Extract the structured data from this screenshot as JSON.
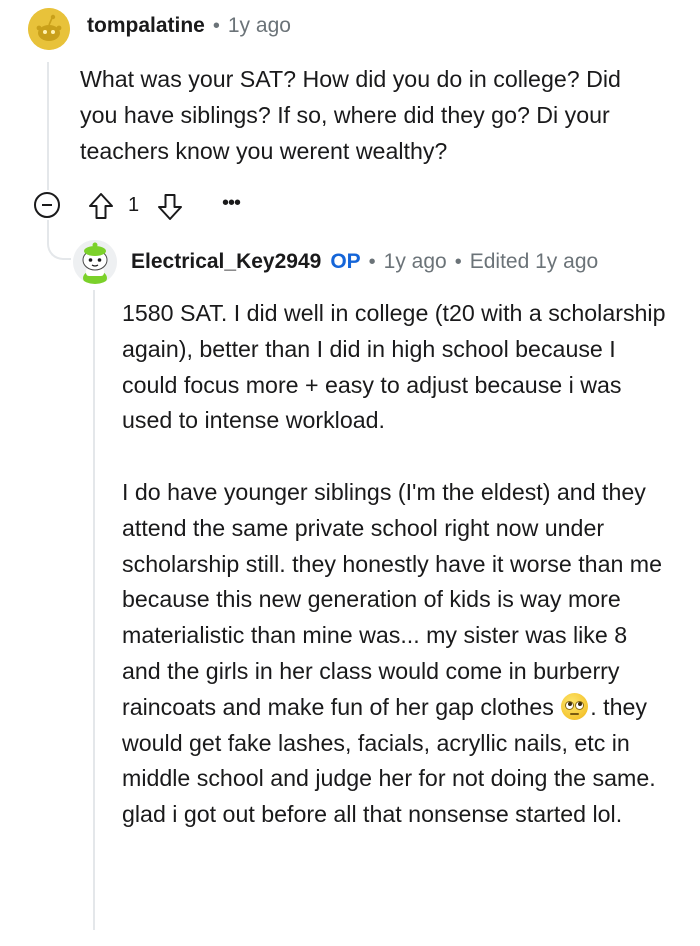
{
  "parent_comment": {
    "username": "tompalatine",
    "separator": "•",
    "time": "1y ago",
    "body": "What was your SAT? How did you do in college? Did you have siblings? If so, where did they go? Di your teachers know you werent wealthy?",
    "vote_count": "1",
    "icons": {
      "avatar": "reddit-snoo-avatar",
      "collapse": "collapse-thread-icon",
      "upvote": "upvote-arrow-icon",
      "downvote": "downvote-arrow-icon",
      "more": "more-options-icon"
    }
  },
  "reply_comment": {
    "username": "Electrical_Key2949",
    "op_badge": "OP",
    "separator": "•",
    "time": "1y ago",
    "edited": "Edited 1y ago",
    "paragraphs": [
      "1580 SAT. I did well in college (t20 with a scholarship again), better than I did in high school because I could focus more + easy to adjust because i was used to intense workload.",
      "I do have younger siblings (I'm the eldest) and they attend the same private school right now under scholarship still. they honestly have it worse than me because this new generation of kids is way more materialistic than mine was... my sister was like 8 and the girls in her class would come in burberry raincoats and make fun of her gap clothes",
      ". they would get fake lashes, facials, acryllic nails, etc in middle school and judge her for not doing the same. glad i got out before all that nonsense started lol."
    ],
    "emoji": "face-with-rolling-eyes",
    "icons": {
      "avatar": "green-snoo-avatar"
    }
  },
  "colors": {
    "text": "#1a1a1b",
    "meta": "#6b7378",
    "op_badge": "#1565d8",
    "thread_line": "#e4e7ea",
    "snoo_yellow": "#e8c23a"
  }
}
